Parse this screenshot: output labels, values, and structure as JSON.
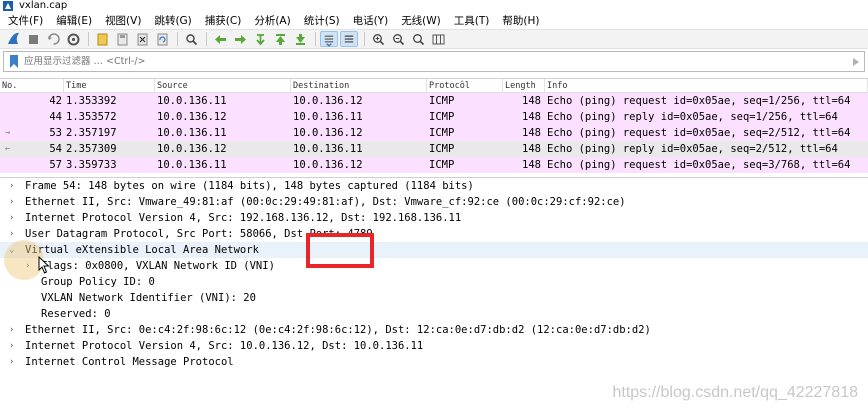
{
  "window": {
    "title": "vxlan.cap",
    "watermark_top": ""
  },
  "menu": [
    "文件(F)",
    "编辑(E)",
    "视图(V)",
    "跳转(G)",
    "捕获(C)",
    "分析(A)",
    "统计(S)",
    "电话(Y)",
    "无线(W)",
    "工具(T)",
    "帮助(H)"
  ],
  "toolbar": {
    "icons": [
      "shark-fin-icon",
      "stop-icon",
      "restart-capture-icon",
      "capture-options-icon",
      "open-file-icon",
      "save-file-icon",
      "close-file-icon",
      "reload-icon",
      "find-packet-icon",
      "go-back-icon",
      "go-forward-icon",
      "go-to-packet-icon",
      "go-to-first-icon",
      "go-to-last-icon",
      "autoscroll-icon",
      "colorize-icon",
      "zoom-in-icon",
      "zoom-out-icon",
      "zoom-reset-icon",
      "resize-columns-icon"
    ],
    "active": [
      "autoscroll-icon",
      "colorize-icon"
    ]
  },
  "filter": {
    "placeholder": "应用显示过滤器 … <Ctrl-/>",
    "value": ""
  },
  "packet_list": {
    "columns": [
      "No.",
      "Time",
      "Source",
      "Destination",
      "Protocol",
      "Length",
      "Info"
    ],
    "rows": [
      {
        "no": "42",
        "time": "1.353392",
        "source": "10.0.136.11",
        "destination": "10.0.136.12",
        "protocol": "ICMP",
        "length": "148",
        "info": "Echo (ping) request  id=0x05ae, seq=1/256, ttl=64",
        "mark": "",
        "style": "icmp"
      },
      {
        "no": "44",
        "time": "1.353572",
        "source": "10.0.136.12",
        "destination": "10.0.136.11",
        "protocol": "ICMP",
        "length": "148",
        "info": "Echo (ping) reply    id=0x05ae, seq=1/256, ttl=64",
        "mark": "",
        "style": "icmp"
      },
      {
        "no": "53",
        "time": "2.357197",
        "source": "10.0.136.11",
        "destination": "10.0.136.12",
        "protocol": "ICMP",
        "length": "148",
        "info": "Echo (ping) request  id=0x05ae, seq=2/512, ttl=64",
        "mark": "→",
        "style": "icmp"
      },
      {
        "no": "54",
        "time": "2.357309",
        "source": "10.0.136.12",
        "destination": "10.0.136.11",
        "protocol": "ICMP",
        "length": "148",
        "info": "Echo (ping) reply    id=0x05ae, seq=2/512, ttl=64",
        "mark": "←",
        "style": "selected-peer"
      },
      {
        "no": "57",
        "time": "3.359733",
        "source": "10.0.136.11",
        "destination": "10.0.136.12",
        "protocol": "ICMP",
        "length": "148",
        "info": "Echo (ping) request  id=0x05ae, seq=3/768, ttl=64",
        "mark": "",
        "style": "icmp"
      }
    ]
  },
  "details": [
    {
      "arrow": "›",
      "level": 0,
      "text": "Frame 54: 148 bytes on wire (1184 bits), 148 bytes captured (1184 bits)",
      "highlight": false
    },
    {
      "arrow": "›",
      "level": 0,
      "text": "Ethernet II, Src: Vmware_49:81:af (00:0c:29:49:81:af), Dst: Vmware_cf:92:ce (00:0c:29:cf:92:ce)",
      "highlight": false
    },
    {
      "arrow": "›",
      "level": 0,
      "text": "Internet Protocol Version 4, Src: 192.168.136.12, Dst: 192.168.136.11",
      "highlight": false
    },
    {
      "arrow": "›",
      "level": 0,
      "text": "User Datagram Protocol, Src Port: 58066, Dst Port: 4789",
      "highlight": false
    },
    {
      "arrow": "⌄",
      "level": 0,
      "text": "Virtual eXtensible Local Area Network",
      "highlight": true
    },
    {
      "arrow": "›",
      "level": 1,
      "text": "Flags: 0x0800, VXLAN Network ID (VNI)",
      "highlight": false
    },
    {
      "arrow": "",
      "level": 1,
      "text": "Group Policy ID: 0",
      "highlight": false
    },
    {
      "arrow": "",
      "level": 1,
      "text": "VXLAN Network Identifier (VNI): 20",
      "highlight": false
    },
    {
      "arrow": "",
      "level": 1,
      "text": "Reserved: 0",
      "highlight": false
    },
    {
      "arrow": "›",
      "level": 0,
      "text": "Ethernet II, Src: 0e:c4:2f:98:6c:12 (0e:c4:2f:98:6c:12), Dst: 12:ca:0e:d7:db:d2 (12:ca:0e:d7:db:d2)",
      "highlight": false
    },
    {
      "arrow": "›",
      "level": 0,
      "text": "Internet Protocol Version 4, Src: 10.0.136.12, Dst: 10.0.136.11",
      "highlight": false
    },
    {
      "arrow": "›",
      "level": 0,
      "text": "Internet Control Message Protocol",
      "highlight": false
    }
  ],
  "watermark": "https://blog.csdn.net/qq_42227818",
  "colors": {
    "icmp_row": "#fce0ff",
    "selected_peer_row": "#e9e9e9",
    "highlight_row": "#e9f1fb",
    "annotation_box": "#e8262a"
  }
}
